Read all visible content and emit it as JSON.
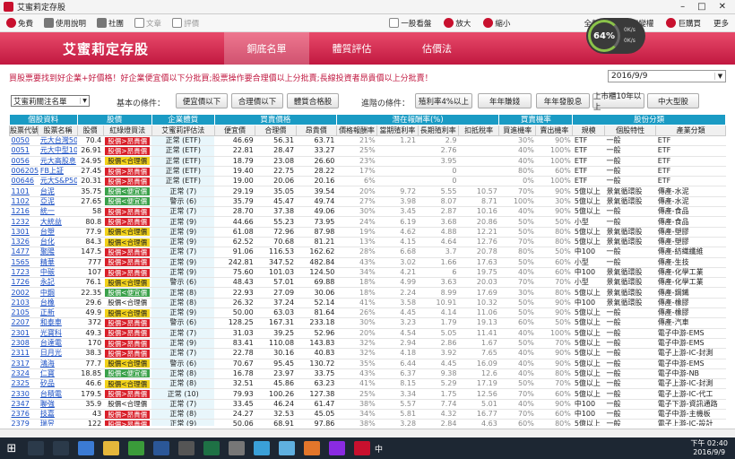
{
  "window": {
    "title": "艾蜜莉定存股"
  },
  "toolbar": {
    "items": [
      "免費",
      "使用說明",
      "社團",
      "文章",
      "評價"
    ],
    "right": [
      "一股看盤",
      "放大",
      "縮小",
      "全營數",
      "修變權",
      "巨購買",
      "更多"
    ]
  },
  "gauge": {
    "value": "64%",
    "up": "0K/s",
    "down": "0K/s"
  },
  "banner": {
    "brand": "艾蜜莉定存股",
    "tabs": [
      "銅底名單",
      "體質評估",
      "估價法"
    ]
  },
  "slogan": "買股票要找到好企業+好價格！好企業便宜價以下分批買;股票操作要合理價以上分批賣;長線投資者昂貴價以上分批賣！",
  "date": "2016/9/9",
  "filters": {
    "list": "艾蜜莉關注名單",
    "basic_label": "基本の條件：",
    "basic": [
      "便宜價以下",
      "合理價以下",
      "體質合格股"
    ],
    "adv_label": "進階の條件：",
    "adv": [
      "殖利率4%以上",
      "年年賺錢",
      "年年發股息",
      "上市櫃10年以上",
      "中大型股"
    ]
  },
  "groups": [
    "個股資料",
    "股價",
    "企業體質",
    "買賣價格",
    "潛在報酬率(%)",
    "買賣機率",
    "股份分類"
  ],
  "columns": [
    "股票代號",
    "股票名稱",
    "股價",
    "紅綠燈買法",
    "艾蜜莉評估法",
    "便宜價",
    "合理價",
    "昂貴價",
    "價格報酬率",
    "當期殖利率",
    "長期殖利率",
    "扣抵稅率",
    "買進機率",
    "賣出機率",
    "規模",
    "個股特性",
    "產業分類"
  ],
  "rows": [
    [
      "0050",
      "元大台灣50",
      "70.4",
      "red",
      "股價>昂貴價",
      "正常 (ETF)",
      "46.69",
      "56.31",
      "63.71",
      "21%",
      "1.21",
      "2.9",
      "",
      "30%",
      "90%",
      "ETF",
      "一般",
      "ETF"
    ],
    [
      "0051",
      "元大中型100",
      "26.91",
      "red",
      "股價>昂貴價",
      "正常 (ETF)",
      "22.81",
      "28.47",
      "33.27",
      "25%",
      "",
      "2.76",
      "",
      "40%",
      "100%",
      "ETF",
      "一般",
      "ETF"
    ],
    [
      "0056",
      "元大高股息",
      "24.95",
      "yellow",
      "股價<合理價",
      "正常 (ETF)",
      "18.79",
      "23.08",
      "26.60",
      "23%",
      "",
      "3.95",
      "",
      "40%",
      "100%",
      "ETF",
      "一般",
      "ETF"
    ],
    [
      "006205",
      "FB上証",
      "27.45",
      "red",
      "股價>昂貴價",
      "正常 (ETF)",
      "19.40",
      "22.75",
      "28.22",
      "17%",
      "",
      "0",
      "",
      "80%",
      "60%",
      "ETF",
      "一般",
      "ETF"
    ],
    [
      "00646",
      "元大S&P500",
      "20.31",
      "red",
      "股價>昂貴價",
      "正常 (ETF)",
      "19.00",
      "20.06",
      "20.16",
      "6%",
      "",
      "0",
      "",
      "0%",
      "100%",
      "ETF",
      "一般",
      "ETF"
    ],
    [
      "1101",
      "台泥",
      "35.75",
      "green",
      "股價<便宜價",
      "正常 (7)",
      "29.19",
      "35.05",
      "39.54",
      "20%",
      "9.72",
      "5.55",
      "10.57",
      "70%",
      "90%",
      "5億以上",
      "景氣循環股",
      "傳產-水泥"
    ],
    [
      "1102",
      "亞泥",
      "27.65",
      "green",
      "股價<便宜價",
      "警示 (6)",
      "35.79",
      "45.47",
      "49.74",
      "27%",
      "3.98",
      "8.07",
      "8.71",
      "100%",
      "30%",
      "5億以上",
      "景氣循環股",
      "傳產-水泥"
    ],
    [
      "1216",
      "統一",
      "58",
      "red",
      "股價>昂貴價",
      "正常 (7)",
      "28.70",
      "37.38",
      "49.06",
      "30%",
      "3.45",
      "2.87",
      "10.16",
      "40%",
      "90%",
      "5億以上",
      "一般",
      "傳產-食品"
    ],
    [
      "1232",
      "大統益",
      "80.8",
      "red",
      "股價>昂貴價",
      "正常 (9)",
      "44.66",
      "55.23",
      "73.95",
      "24%",
      "6.19",
      "3.68",
      "20.86",
      "50%",
      "50%",
      "小型",
      "一般",
      "傳產-食品"
    ],
    [
      "1301",
      "台塑",
      "77.9",
      "yellow",
      "股價<合理價",
      "正常 (9)",
      "61.08",
      "72.96",
      "87.98",
      "19%",
      "4.62",
      "4.88",
      "12.21",
      "50%",
      "80%",
      "5億以上",
      "景氣循環股",
      "傳產-塑膠"
    ],
    [
      "1326",
      "台化",
      "84.3",
      "yellow",
      "股價<合理價",
      "正常 (9)",
      "62.52",
      "70.68",
      "81.21",
      "13%",
      "4.15",
      "4.64",
      "12.76",
      "70%",
      "80%",
      "5億以上",
      "景氣循環股",
      "傳產-塑膠"
    ],
    [
      "1477",
      "聚陽",
      "147.5",
      "red",
      "股價>昂貴價",
      "正常 (7)",
      "91.06",
      "116.53",
      "162.62",
      "28%",
      "6.68",
      "3.7",
      "20.78",
      "80%",
      "50%",
      "中100",
      "一般",
      "傳產-紡織纖維"
    ],
    [
      "1565",
      "精華",
      "777",
      "red",
      "股價>昂貴價",
      "正常 (9)",
      "242.81",
      "347.52",
      "482.84",
      "43%",
      "3.02",
      "1.66",
      "17.63",
      "50%",
      "60%",
      "小型",
      "一般",
      "傳產-生技"
    ],
    [
      "1723",
      "中碳",
      "107",
      "red",
      "股價>昂貴價",
      "正常 (9)",
      "75.60",
      "101.03",
      "124.50",
      "34%",
      "4.21",
      "6",
      "19.75",
      "40%",
      "60%",
      "中100",
      "景氣循環股",
      "傳產-化學工業"
    ],
    [
      "1726",
      "永記",
      "76.1",
      "yellow",
      "股價<合理價",
      "警示 (6)",
      "48.43",
      "57.01",
      "69.88",
      "18%",
      "4.99",
      "3.63",
      "20.03",
      "70%",
      "70%",
      "小型",
      "景氣循環股",
      "傳產-化學工業"
    ],
    [
      "2002",
      "中鋼",
      "22.35",
      "green",
      "股價<便宜價",
      "正常 (8)",
      "22.93",
      "27.09",
      "30.06",
      "18%",
      "2.24",
      "8.99",
      "17.69",
      "30%",
      "80%",
      "5億以上",
      "景氣循環股",
      "傳產-鋼鐵"
    ],
    [
      "2103",
      "台橡",
      "29.6",
      "white",
      "股價<合理價",
      "正常 (8)",
      "26.32",
      "37.24",
      "52.14",
      "41%",
      "3.58",
      "10.91",
      "10.32",
      "50%",
      "90%",
      "中100",
      "景氣循環股",
      "傳產-橡膠"
    ],
    [
      "2105",
      "正新",
      "49.9",
      "yellow",
      "股價<合理價",
      "正常 (9)",
      "50.00",
      "63.03",
      "81.64",
      "26%",
      "4.45",
      "4.14",
      "11.06",
      "50%",
      "90%",
      "5億以上",
      "一般",
      "傳產-橡膠"
    ],
    [
      "2207",
      "和泰車",
      "372",
      "red",
      "股價>昂貴價",
      "警示 (6)",
      "128.25",
      "167.31",
      "233.18",
      "30%",
      "3.23",
      "1.79",
      "19.13",
      "60%",
      "50%",
      "5億以上",
      "一般",
      "傳產-汽車"
    ],
    [
      "2301",
      "光寶科",
      "49.3",
      "red",
      "股價>昂貴價",
      "正常 (7)",
      "31.03",
      "39.25",
      "52.96",
      "20%",
      "4.54",
      "5.05",
      "11.41",
      "40%",
      "100%",
      "5億以上",
      "一般",
      "電子中游-EMS"
    ],
    [
      "2308",
      "台達電",
      "170",
      "red",
      "股價>昂貴價",
      "正常 (9)",
      "83.41",
      "110.08",
      "143.83",
      "32%",
      "2.94",
      "2.86",
      "1.67",
      "50%",
      "70%",
      "5億以上",
      "一般",
      "電子中游-EMS"
    ],
    [
      "2311",
      "日月光",
      "38.3",
      "red",
      "股價>昂貴價",
      "正常 (7)",
      "22.78",
      "30.16",
      "40.83",
      "32%",
      "4.18",
      "3.92",
      "7.65",
      "40%",
      "90%",
      "5億以上",
      "一般",
      "電子上游-IC-封測"
    ],
    [
      "2317",
      "鴻海",
      "77.7",
      "yellow",
      "股價<合理價",
      "警示 (6)",
      "70.67",
      "95.45",
      "130.72",
      "35%",
      "6.44",
      "4.45",
      "16.09",
      "40%",
      "90%",
      "5億以上",
      "一般",
      "電子中游-EMS"
    ],
    [
      "2324",
      "仁寶",
      "18.85",
      "green",
      "股價<便宜價",
      "正常 (8)",
      "16.78",
      "23.97",
      "33.75",
      "43%",
      "6.37",
      "9.38",
      "12.6",
      "40%",
      "80%",
      "5億以上",
      "一般",
      "電子中游-NB"
    ],
    [
      "2325",
      "矽品",
      "46.6",
      "yellow",
      "股價<合理價",
      "正常 (8)",
      "32.51",
      "45.86",
      "63.23",
      "41%",
      "8.15",
      "5.29",
      "17.19",
      "50%",
      "70%",
      "5億以上",
      "一般",
      "電子上游-IC-封測"
    ],
    [
      "2330",
      "台積電",
      "179.5",
      "red",
      "股價>昂貴價",
      "正常 (10)",
      "79.93",
      "100.26",
      "127.38",
      "25%",
      "3.34",
      "1.75",
      "12.56",
      "70%",
      "60%",
      "5億以上",
      "一般",
      "電子上游-IC-代工"
    ],
    [
      "2347",
      "聯強",
      "35.9",
      "white",
      "股價<合理價",
      "正常 (7)",
      "33.45",
      "46.24",
      "61.47",
      "38%",
      "5.57",
      "7.74",
      "5.01",
      "40%",
      "90%",
      "中100",
      "一般",
      "電子下游-資訊通路"
    ],
    [
      "2376",
      "技嘉",
      "43",
      "red",
      "股價>昂貴價",
      "正常 (8)",
      "24.27",
      "32.53",
      "45.05",
      "34%",
      "5.81",
      "4.32",
      "16.77",
      "70%",
      "60%",
      "中100",
      "一般",
      "電子中游-主機板"
    ],
    [
      "2379",
      "瑞昱",
      "122",
      "red",
      "股價>昂貴價",
      "正常 (9)",
      "50.06",
      "68.91",
      "97.86",
      "38%",
      "3.28",
      "2.84",
      "4.63",
      "60%",
      "80%",
      "5億以上",
      "一般",
      "電子上游-IC-設計"
    ],
    [
      "2382",
      "廣達",
      "62",
      "red",
      "股價>昂貴價",
      "正常 (8)",
      "47.69",
      "61.07",
      "81.45",
      "28%",
      "6.13",
      "5.78",
      "23.64",
      "50%",
      "80%",
      "5億以上",
      "一般",
      "電子中游-NB"
    ]
  ],
  "taskbar": {
    "time": "下午 02:40",
    "date": "2016/9/9",
    "ime": "中"
  }
}
